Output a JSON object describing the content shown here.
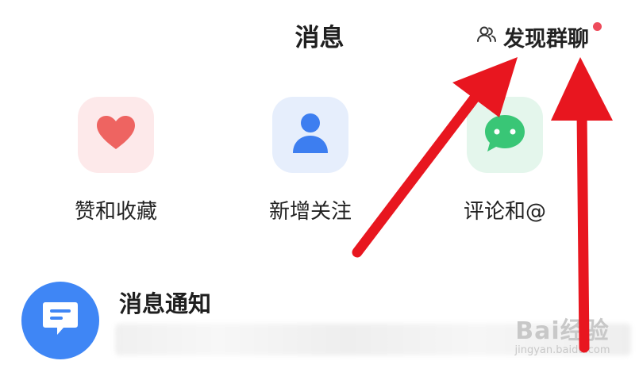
{
  "header": {
    "title": "消息",
    "discover_label": "发现群聊",
    "discover_icon": "group-users-icon",
    "badge_color": "#ee4b5b"
  },
  "shortcuts": [
    {
      "label": "赞和收藏",
      "icon": "heart-icon",
      "color": "#ee6461"
    },
    {
      "label": "新增关注",
      "icon": "user-icon",
      "color": "#3d7ef0"
    },
    {
      "label": "评论和@",
      "icon": "chat-bubble-icon",
      "color": "#39c676"
    }
  ],
  "notification": {
    "title": "消息通知",
    "icon": "message-icon",
    "icon_color": "#3f86f5"
  },
  "watermark": {
    "main": "Bai经验",
    "sub": "jingyan.baidu.com"
  },
  "annotation": {
    "arrow_color": "#e8161f"
  }
}
